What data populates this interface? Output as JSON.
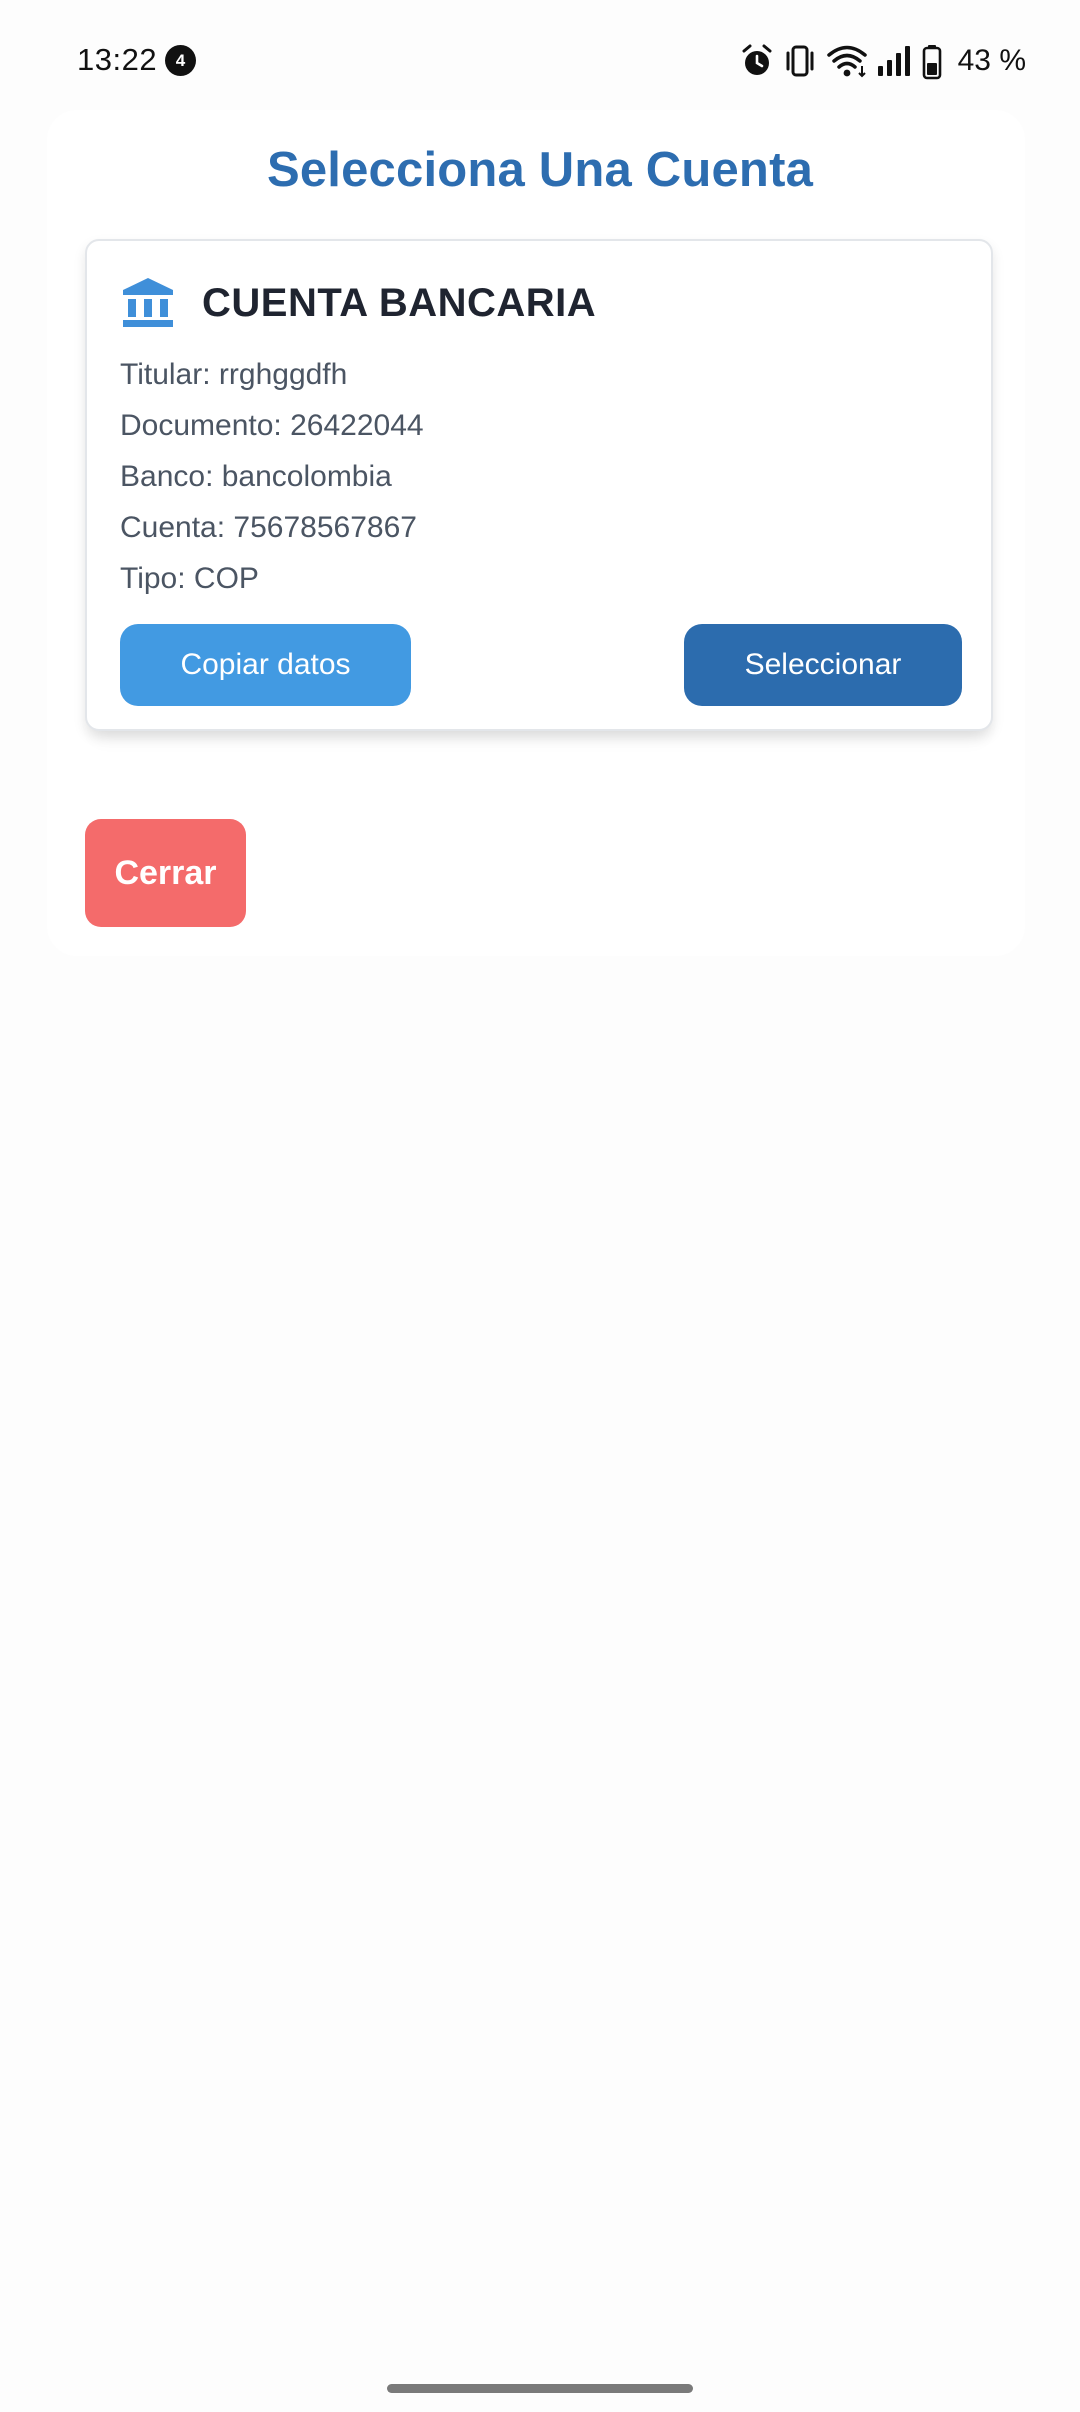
{
  "status_bar": {
    "time": "13:22",
    "notification_count": "4",
    "battery": "43 %"
  },
  "page": {
    "title": "Selecciona Una Cuenta"
  },
  "card": {
    "icon": "bank-icon",
    "title": "CUENTA BANCARIA",
    "fields": [
      "Titular: rrghggdfh",
      "Documento: 26422044",
      "Banco: bancolombia",
      "Cuenta: 75678567867",
      "Tipo: COP"
    ],
    "copy_label": "Copiar datos",
    "select_label": "Seleccionar"
  },
  "close_label": "Cerrar",
  "colors": {
    "title": "#2d6db0",
    "copy_button": "#429ae2",
    "select_button": "#2c6cae",
    "close_button": "#f46b6b"
  }
}
